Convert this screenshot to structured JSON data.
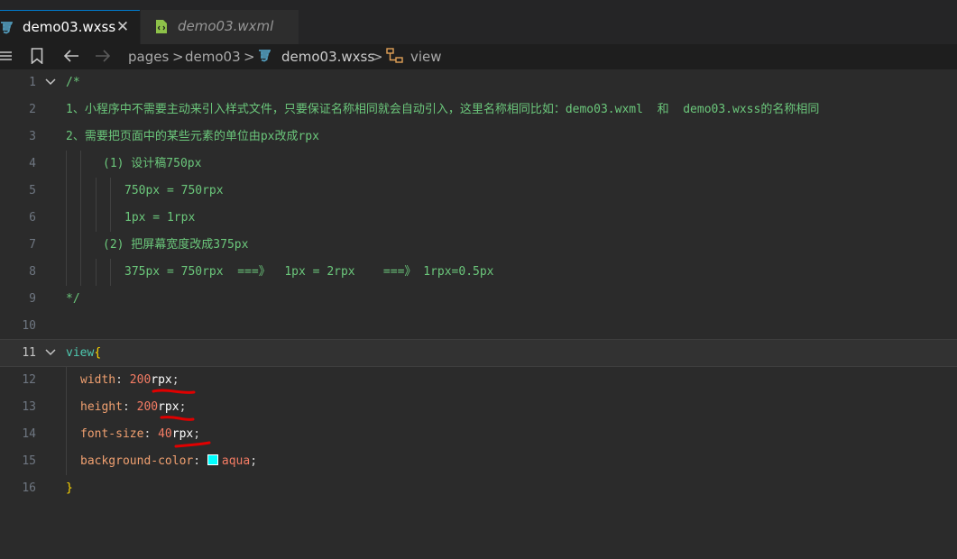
{
  "tabs": [
    {
      "label": "demo03.wxss",
      "close": "✕",
      "icon": "css3-icon",
      "active": true
    },
    {
      "label": "demo03.wxml",
      "icon": "wxml-icon",
      "active": false
    }
  ],
  "breadcrumb": {
    "items": [
      "pages",
      "demo03",
      "demo03.wxss",
      "view"
    ],
    "separator": ">"
  },
  "lines": [
    {
      "n": "1",
      "text": "/*"
    },
    {
      "n": "2",
      "text": "1、小程序中不需要主动来引入样式文件，只要保证名称相同就会自动引入，这里名称相同比如：demo03.wxml  和  demo03.wxss的名称相同"
    },
    {
      "n": "3",
      "text": "2、需要把页面中的某些元素的单位由px改成rpx"
    },
    {
      "n": "4",
      "text": "(1) 设计稿750px"
    },
    {
      "n": "5",
      "text": "750px = 750rpx"
    },
    {
      "n": "6",
      "text": "1px = 1rpx"
    },
    {
      "n": "7",
      "text": "(2) 把屏幕宽度改成375px"
    },
    {
      "n": "8",
      "text": "375px = 750rpx  ===》  1px = 2rpx    ===》 1rpx=0.5px"
    },
    {
      "n": "9",
      "text": "*/"
    },
    {
      "n": "10",
      "text": ""
    },
    {
      "n": "11",
      "selector": "view",
      "brace": "{"
    },
    {
      "n": "12",
      "prop": "width",
      "colon": ": ",
      "num": "200",
      "unit": "rpx",
      "semi": ";"
    },
    {
      "n": "13",
      "prop": "height",
      "colon": ": ",
      "num": "200",
      "unit": "rpx",
      "semi": ";"
    },
    {
      "n": "14",
      "prop": "font-size",
      "colon": ": ",
      "num": "40",
      "unit": "rpx",
      "semi": ";"
    },
    {
      "n": "15",
      "prop": "background-color",
      "colon": ": ",
      "val": "aqua",
      "semi": ";"
    },
    {
      "n": "16",
      "brace": "}"
    }
  ],
  "colors": {
    "comment": "#6bc77b",
    "selector": "#4ec9b0",
    "property": "#f0a070",
    "number": "#f47c64",
    "swatch": "#00ffff",
    "annotation": "#e00000",
    "accent": "#007acc"
  }
}
